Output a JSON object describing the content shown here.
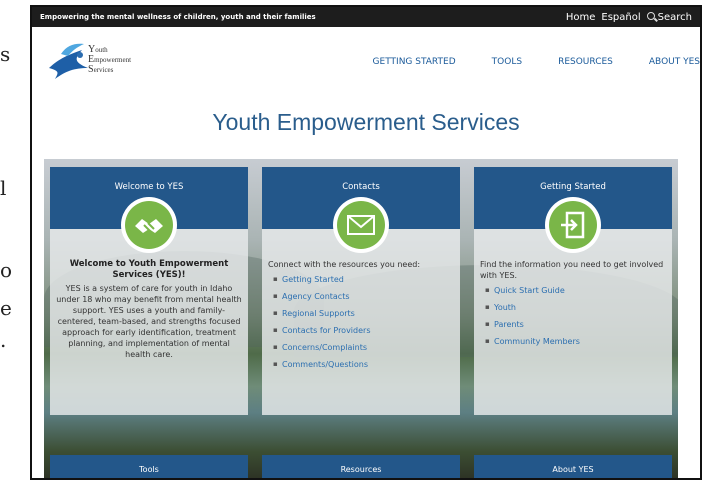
{
  "side_fragments": [
    "s",
    "l",
    "o",
    "e",
    "."
  ],
  "topbar": {
    "tagline": "Empowering the mental wellness of children, youth and their families",
    "home": "Home",
    "espanol": "Español",
    "search": "Search"
  },
  "logo": {
    "line1_initial": "Y",
    "line1": "outh",
    "line2_initial": "E",
    "line2": "mpowerment",
    "line3_initial": "S",
    "line3": "ervices"
  },
  "nav": {
    "items": [
      "GETTING STARTED",
      "TOOLS",
      "RESOURCES",
      "ABOUT YES"
    ]
  },
  "page_title": "Youth Empowerment Services",
  "cards": {
    "welcome": {
      "header": "Welcome to YES",
      "title": "Welcome to Youth Empowerment Services (YES)!",
      "text": "YES is a system of care for youth in Idaho under 18 who may benefit from mental health support. YES uses a youth and family-centered, team-based, and strengths focused approach for early identification, treatment planning, and implementation of mental health care."
    },
    "contacts": {
      "header": "Contacts",
      "intro": "Connect with the resources you need:",
      "links": [
        "Getting Started",
        "Agency Contacts",
        "Regional Supports",
        "Contacts for Providers",
        "Concerns/Complaints",
        "Comments/Questions"
      ]
    },
    "getting_started": {
      "header": "Getting Started",
      "intro": "Find the information you need to get involved with YES.",
      "links": [
        "Quick Start Guide",
        "Youth",
        "Parents",
        "Community Members"
      ]
    }
  },
  "bottom_cards": [
    "Tools",
    "Resources",
    "About YES"
  ],
  "colors": {
    "accent_blue": "#23578a",
    "title_blue": "#2a5d8c",
    "link_blue": "#2c6fb0",
    "badge_green": "#7ab648"
  }
}
